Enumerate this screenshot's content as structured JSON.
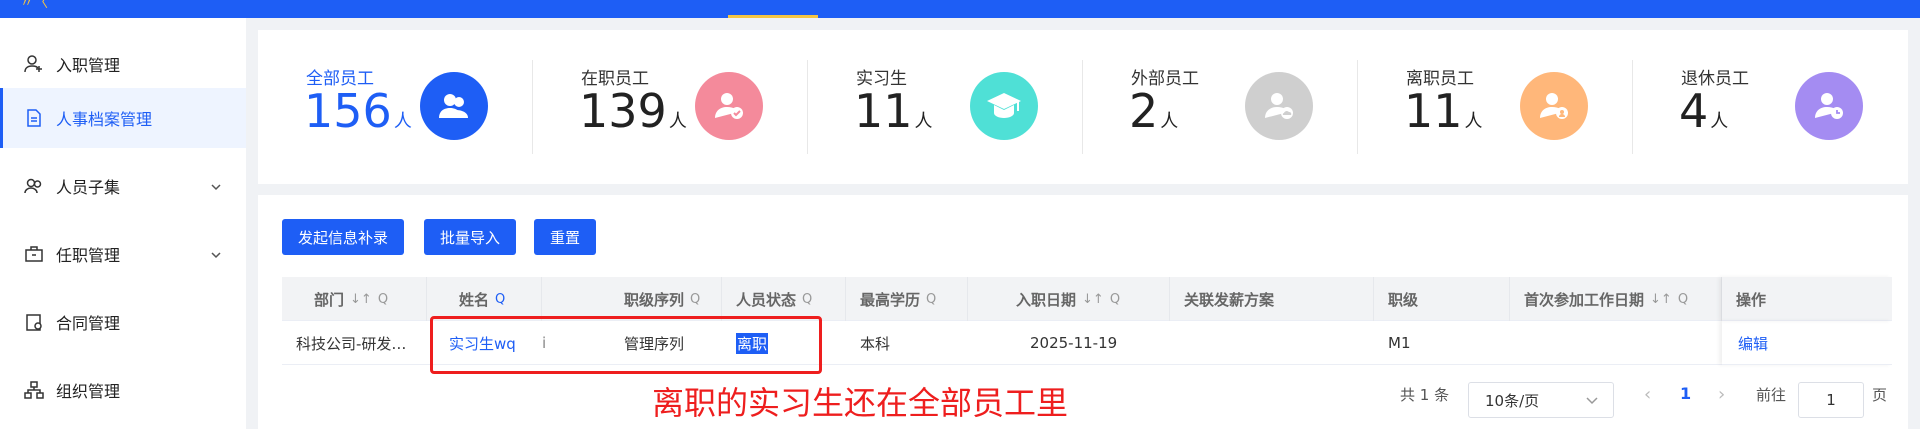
{
  "sidebar": {
    "items": [
      {
        "label": "入职管理",
        "icon": "user-add-icon"
      },
      {
        "label": "人事档案管理",
        "icon": "document-icon",
        "active": true
      },
      {
        "label": "人员子集",
        "icon": "users-icon",
        "expandable": true
      },
      {
        "label": "任职管理",
        "icon": "briefcase-icon",
        "expandable": true
      },
      {
        "label": "合同管理",
        "icon": "contract-icon"
      },
      {
        "label": "组织管理",
        "icon": "org-chart-icon"
      }
    ]
  },
  "stats": [
    {
      "label": "全部员工",
      "value": "156",
      "unit": "人",
      "color": "#1e5ef5"
    },
    {
      "label": "在职员工",
      "value": "139",
      "unit": "人",
      "color": "#f48a9b"
    },
    {
      "label": "实习生",
      "value": "11",
      "unit": "人",
      "color": "#4fe0d6"
    },
    {
      "label": "外部员工",
      "value": "2",
      "unit": "人",
      "color": "#cfcfcf"
    },
    {
      "label": "离职员工",
      "value": "11",
      "unit": "人",
      "color": "#ffb77a"
    },
    {
      "label": "退休员工",
      "value": "4",
      "unit": "人",
      "color": "#a48cf2"
    }
  ],
  "toolbar": {
    "initiate_label": "发起信息补录",
    "import_label": "批量导入",
    "reset_label": "重置"
  },
  "table": {
    "headers": [
      "部门",
      "姓名",
      "职级序列",
      "人员状态",
      "最高学历",
      "入职日期",
      "关联发薪方案",
      "职级",
      "首次参加工作日期",
      "操作"
    ],
    "row": {
      "dept": "科技公司-研发…",
      "name": "实习生wq",
      "frag": "i",
      "rank_series": "管理序列",
      "status": "离职",
      "education": "本科",
      "hire_date": "2025-11-19",
      "pay_plan": "",
      "rank": "M1",
      "first_work_date": "",
      "action": "编辑"
    }
  },
  "annotation": "离职的实习生还在全部员工里",
  "pagination": {
    "total": "共 1 条",
    "page_size": "10条/页",
    "current": "1",
    "goto_label": "前往",
    "goto_value": "1",
    "page_suffix": "页"
  }
}
